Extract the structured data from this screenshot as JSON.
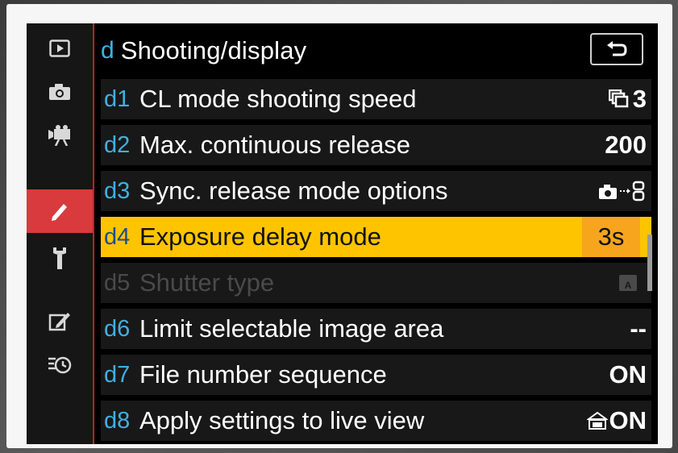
{
  "menu": {
    "letter": "d",
    "title": "Shooting/display"
  },
  "sidebar": {
    "tabs": [
      {
        "name": "playback-menu-tab",
        "icon": "playback-icon"
      },
      {
        "name": "photo-shooting-menu-tab",
        "icon": "camera-icon"
      },
      {
        "name": "movie-shooting-menu-tab",
        "icon": "movie-camera-icon"
      },
      {
        "name": "custom-settings-menu-tab",
        "icon": "pencil-icon",
        "active": true
      },
      {
        "name": "setup-menu-tab",
        "icon": "wrench-icon"
      },
      {
        "name": "retouch-menu-tab",
        "icon": "retouch-icon"
      },
      {
        "name": "recent-settings-menu-tab",
        "icon": "recent-clock-icon"
      }
    ]
  },
  "items": [
    {
      "code": "d1",
      "label": "CL mode shooting speed",
      "value": "3",
      "value_icon": "continuous-low-icon"
    },
    {
      "code": "d2",
      "label": "Max. continuous release",
      "value": "200"
    },
    {
      "code": "d3",
      "label": "Sync. release mode options",
      "value": "",
      "value_icon": "camera-sync-icon"
    },
    {
      "code": "d4",
      "label": "Exposure delay mode",
      "value": "3s",
      "selected": true
    },
    {
      "code": "d5",
      "label": "Shutter type",
      "value": "",
      "value_icon": "shutter-auto-icon",
      "disabled": true
    },
    {
      "code": "d6",
      "label": "Limit selectable image area",
      "value": "--"
    },
    {
      "code": "d7",
      "label": "File number sequence",
      "value": "ON"
    },
    {
      "code": "d8",
      "label": "Apply settings to live view",
      "value": "ON",
      "value_icon": "live-view-icon"
    }
  ],
  "colors": {
    "accent_blue": "#3fb0e6",
    "active_tab": "#d93a3e",
    "highlight": "#ffc400",
    "highlight_value": "#f7a51c"
  }
}
